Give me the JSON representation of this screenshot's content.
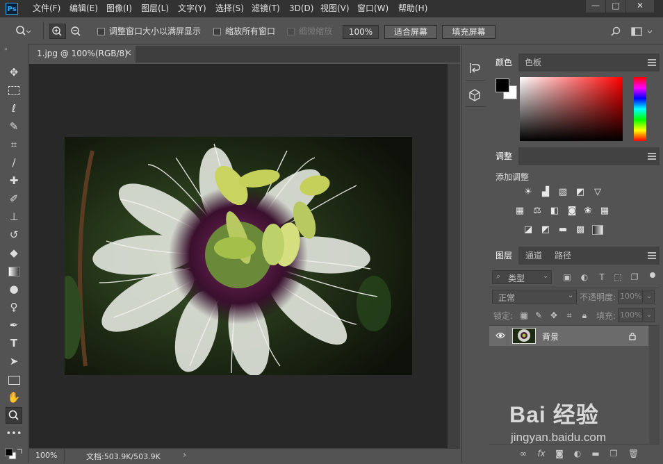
{
  "app": {
    "logo_text": "Ps"
  },
  "menu": [
    {
      "label": "文件(F)"
    },
    {
      "label": "编辑(E)"
    },
    {
      "label": "图像(I)"
    },
    {
      "label": "图层(L)"
    },
    {
      "label": "文字(Y)"
    },
    {
      "label": "选择(S)"
    },
    {
      "label": "滤镜(T)"
    },
    {
      "label": "3D(D)"
    },
    {
      "label": "视图(V)"
    },
    {
      "label": "窗口(W)"
    },
    {
      "label": "帮助(H)"
    }
  ],
  "window_controls": {
    "minimize": "—",
    "maximize": "□",
    "close": "✕"
  },
  "options": {
    "resize_windows_label": "调整窗口大小以满屏显示",
    "zoom_all_label": "缩放所有窗口",
    "scrubby_zoom_label": "细微缩放",
    "zoom_value": "100%",
    "fit_screen_label": "适合屏幕",
    "fill_screen_label": "填充屏幕"
  },
  "document": {
    "tab_title": "1.jpg @ 100%(RGB/8)",
    "tab_close": "×",
    "status_zoom": "100%",
    "status_doc": "文档:503.9K/503.9K",
    "status_arrow": "›"
  },
  "panels": {
    "color": {
      "tabs": [
        {
          "label": "颜色"
        },
        {
          "label": "色板"
        }
      ],
      "foreground": "#000000",
      "background": "#ffffff"
    },
    "adjustments": {
      "tab": "调整",
      "title": "添加调整"
    },
    "layers": {
      "tabs": [
        {
          "label": "图层"
        },
        {
          "label": "通道"
        },
        {
          "label": "路径"
        }
      ],
      "filter_kind": "类型",
      "blend_mode": "正常",
      "opacity_label": "不透明度:",
      "opacity_value": "100%",
      "lock_label": "锁定:",
      "fill_label": "填充:",
      "fill_value": "100%",
      "items": [
        {
          "name": "背景",
          "visible": true,
          "locked": true
        }
      ]
    }
  },
  "watermark": {
    "brand": "Bai 经验",
    "url": "jingyan.baidu.com"
  }
}
